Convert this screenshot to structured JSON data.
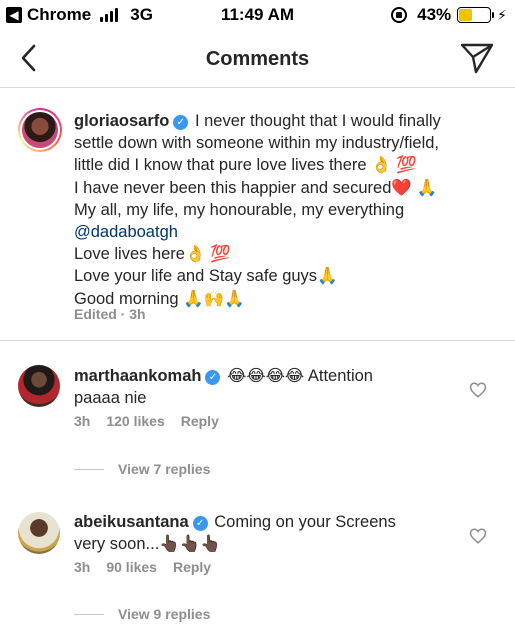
{
  "status_bar": {
    "app": "Chrome",
    "carrier": "3G",
    "time": "11:49 AM",
    "battery_percent": "43%",
    "battery_level": 0.43
  },
  "header": {
    "title": "Comments"
  },
  "caption": {
    "username": "gloriaosarfo",
    "lines": [
      "I never thought that I would finally",
      "settle down with someone within my industry/field,",
      "little did I know that pure love lives there 👌 💯",
      "I have never been this happier and secured❤️ 🙏",
      "My all, my life, my honourable, my everything"
    ],
    "mention": "@dadaboatgh",
    "lines_after": [
      "Love lives here👌 💯",
      "Love your life and Stay safe guys🙏",
      "Good morning 🙏🙌🙏"
    ],
    "meta": "Edited · 3h"
  },
  "comments": [
    {
      "username": "marthaankomah",
      "text_first": "😂😂😂😂 Attention",
      "text_second": "paaaa nie",
      "time": "3h",
      "likes": "120 likes",
      "reply": "Reply",
      "view_replies": "View 7 replies"
    },
    {
      "username": "abeikusantana",
      "text_first": "Coming on your Screens",
      "text_second": "very soon...👆🏿👆🏿👆🏿",
      "time": "3h",
      "likes": "90 likes",
      "reply": "Reply",
      "view_replies": "View 9 replies"
    }
  ],
  "icons": {
    "back": "chevron-left-icon",
    "send": "paper-plane-icon",
    "heart": "heart-outline-icon",
    "verified": "verified-badge-icon"
  },
  "colors": {
    "verified": "#3897f0",
    "mention": "#003569",
    "secondary_text": "#8e8e8e",
    "battery": "#f2c200"
  }
}
